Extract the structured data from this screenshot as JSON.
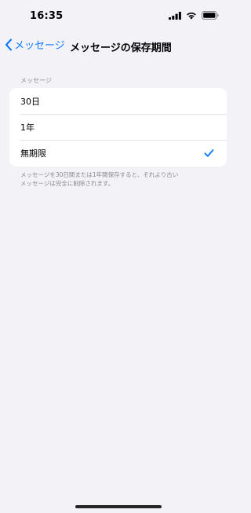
{
  "status_bar": {
    "time": "16:35",
    "icons": [
      "cellular-signal-icon",
      "wifi-icon",
      "battery-icon"
    ]
  },
  "nav": {
    "back_label": "メッセージ",
    "title": "メッセージの保存期間"
  },
  "section": {
    "header": "メッセージ",
    "options": [
      {
        "label": "30日",
        "selected": false
      },
      {
        "label": "1年",
        "selected": false
      },
      {
        "label": "無期限",
        "selected": true
      }
    ],
    "footer_line1": "メッセージを30日間または1年間保存すると、それより古い",
    "footer_line2": "メッセージは完全に削除されます。"
  },
  "colors": {
    "accent": "#0a7aff",
    "background": "#f2f2f7",
    "secondary_text": "#8a8a8e"
  }
}
